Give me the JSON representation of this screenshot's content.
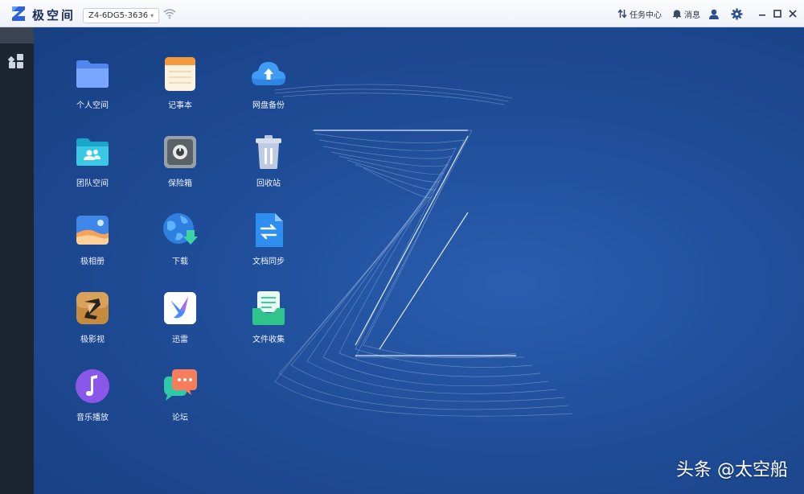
{
  "titlebar": {
    "app_title": "极空间",
    "device_name": "Z4-6DG5-3636",
    "task_center": "任务中心",
    "messages": "消息"
  },
  "icons": {
    "logo": "zspace-logo-icon",
    "wifi": "wifi-icon",
    "task": "transfer-arrows-icon",
    "bell": "bell-icon",
    "user": "user-icon",
    "settings": "gear-icon",
    "minimize": "minimize-icon",
    "maximize": "maximize-icon",
    "close": "close-icon",
    "sidebar": "app-grid-icon"
  },
  "apps": {
    "col1": [
      "个人空间",
      "团队空间",
      "极相册",
      "极影视",
      "音乐播放"
    ],
    "col2": [
      "记事本",
      "保险箱",
      "下载",
      "迅雷",
      "论坛"
    ],
    "col3": [
      "网盘备份",
      "回收站",
      "文档同步",
      "文件收集"
    ]
  },
  "watermark": "头条 @太空船",
  "colors": {
    "desktop": "#1f4d98",
    "sidebar": "#1c2532",
    "titlebar": "#f3f6fb",
    "accent": "#3b8df5"
  }
}
